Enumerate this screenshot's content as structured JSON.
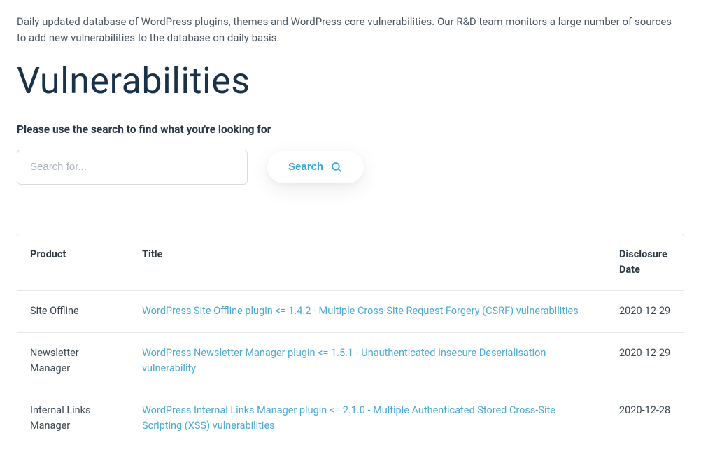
{
  "intro": "Daily updated database of WordPress plugins, themes and WordPress core vulnerabilities. Our R&D team monitors a large number of sources to add new vulnerabilities to the database on daily basis.",
  "page_title": "Vulnerabilities",
  "search": {
    "label": "Please use the search to find what you're looking for",
    "placeholder": "Search for...",
    "button_label": "Search"
  },
  "table": {
    "headers": {
      "product": "Product",
      "title": "Title",
      "date": "Disclosure Date"
    },
    "rows": [
      {
        "product": "Site Offline",
        "title": "WordPress Site Offline plugin <= 1.4.2 - Multiple Cross-Site Request Forgery (CSRF) vulnerabilities",
        "date": "2020-12-29"
      },
      {
        "product": "Newsletter Manager",
        "title": "WordPress Newsletter Manager plugin <= 1.5.1 - Unauthenticated Insecure Deserialisation vulnerability",
        "date": "2020-12-29"
      },
      {
        "product": "Internal Links Manager",
        "title": "WordPress Internal Links Manager plugin <= 2.1.0 - Multiple Authenticated Stored Cross-Site Scripting (XSS) vulnerabilities",
        "date": "2020-12-28"
      }
    ]
  }
}
